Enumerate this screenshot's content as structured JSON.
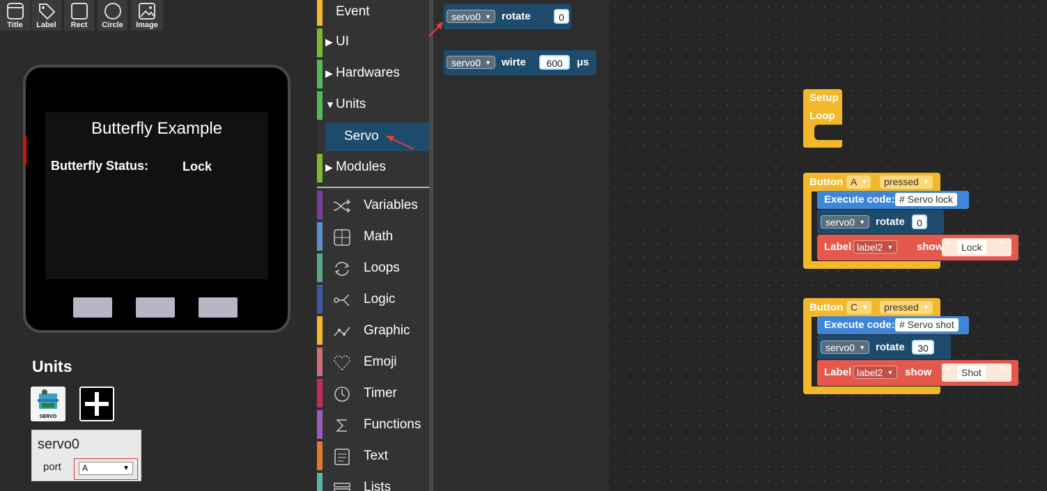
{
  "tools": [
    "Title",
    "Label",
    "Rect",
    "Circle",
    "Image"
  ],
  "device": {
    "screen_title": "Butterfly Example",
    "status_label": "Butterfly Status:",
    "status_value": "Lock"
  },
  "units_panel": {
    "title": "Units",
    "servo_thumb_caption": "SERVO",
    "unit_name": "servo0",
    "port_label": "port",
    "port_value": "A"
  },
  "toolbox": {
    "categories": [
      "Event",
      "UI",
      "Hardwares",
      "Units",
      "Servo",
      "Modules"
    ],
    "builtin": [
      "Variables",
      "Math",
      "Loops",
      "Logic",
      "Graphic",
      "Emoji",
      "Timer",
      "Functions",
      "Text",
      "Lists"
    ]
  },
  "colors": {
    "event": "#f3b82a",
    "ui": "#7dbb2b",
    "hardwares": "#54b85d",
    "units": "#54b85d",
    "modules": "#7dbb2b",
    "variables": "#7a3e9d",
    "math": "#5b8fc9",
    "loops": "#5ba58c",
    "logic": "#3c5aa6",
    "graphic": "#f3b82a",
    "emoji": "#d06d7a",
    "timer": "#c92a5c",
    "functions": "#9a5cb4",
    "text": "#e07a2e",
    "lists": "#5bb4a6"
  },
  "flyout": {
    "rotate": {
      "servo": "servo0",
      "label": "rotate",
      "value": "0"
    },
    "write": {
      "servo": "servo0",
      "label": "wirte",
      "value": "600",
      "unit": "μs"
    }
  },
  "workspace": {
    "setup": "Setup",
    "loop": "Loop",
    "blockA": {
      "button": "Button",
      "key": "A",
      "event": "pressed",
      "exec": "Execute code:",
      "code": "# Servo lock",
      "servo": "servo0",
      "rotate": "rotate",
      "angle": "0",
      "label": "Label",
      "target": "label2",
      "show": "show",
      "text": "Lock"
    },
    "blockC": {
      "button": "Button",
      "key": "C",
      "event": "pressed",
      "exec": "Execute code:",
      "code": "# Servo shot",
      "servo": "servo0",
      "rotate": "rotate",
      "angle": "30",
      "label": "Label",
      "target": "label2",
      "show": "show",
      "text": "Shot"
    }
  }
}
